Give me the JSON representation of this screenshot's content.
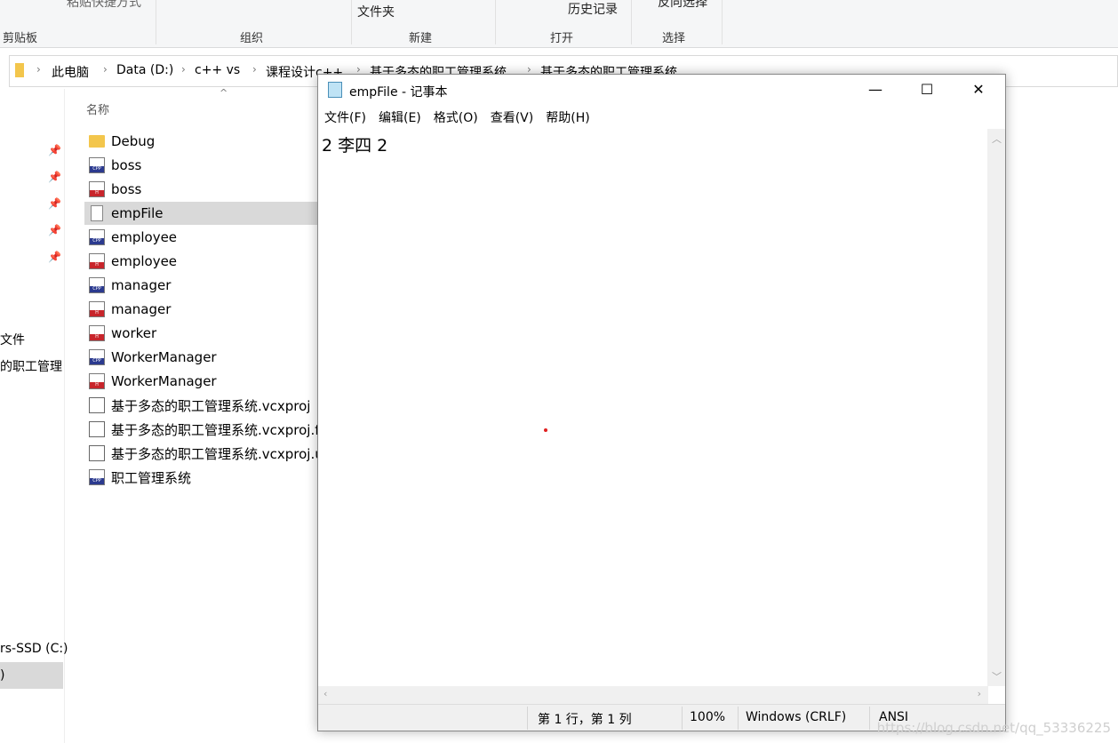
{
  "ribbon": {
    "top_items": [
      "粘贴快捷方式",
      "文件夹",
      "历史记录",
      "反向选择"
    ],
    "groups": [
      "剪贴板",
      "组织",
      "新建",
      "打开",
      "选择"
    ]
  },
  "address": {
    "crumbs": [
      "此电脑",
      "Data (D:)",
      "c++ vs",
      "课程设计c++",
      "基于多态的职工管理系统",
      "基于多态的职工管理系统"
    ]
  },
  "nav": {
    "items": [
      "文件",
      "的职工管理",
      "rs-SSD (C:)",
      ")"
    ]
  },
  "list": {
    "header": "名称",
    "files": [
      {
        "name": "Debug",
        "type": "folder"
      },
      {
        "name": "boss",
        "type": "cpp"
      },
      {
        "name": "boss",
        "type": "h"
      },
      {
        "name": "empFile",
        "type": "txt",
        "selected": true
      },
      {
        "name": "employee",
        "type": "cpp"
      },
      {
        "name": "employee",
        "type": "h"
      },
      {
        "name": "manager",
        "type": "cpp"
      },
      {
        "name": "manager",
        "type": "h"
      },
      {
        "name": "worker",
        "type": "h"
      },
      {
        "name": "WorkerManager",
        "type": "cpp"
      },
      {
        "name": "WorkerManager",
        "type": "h"
      },
      {
        "name": "基于多态的职工管理系统.vcxproj",
        "type": "proj"
      },
      {
        "name": "基于多态的职工管理系统.vcxproj.f",
        "type": "proj"
      },
      {
        "name": "基于多态的职工管理系统.vcxproj.u",
        "type": "proj"
      },
      {
        "name": "职工管理系统",
        "type": "cpp"
      }
    ]
  },
  "notepad": {
    "title": "empFile - 记事本",
    "menu": [
      "文件(F)",
      "编辑(E)",
      "格式(O)",
      "查看(V)",
      "帮助(H)"
    ],
    "content": "2 李四 2",
    "status": {
      "position": "第 1 行，第 1 列",
      "zoom": "100%",
      "eol": "Windows (CRLF)",
      "encoding": "ANSI"
    }
  },
  "watermark": "https://blog.csdn.net/qq_53336225"
}
